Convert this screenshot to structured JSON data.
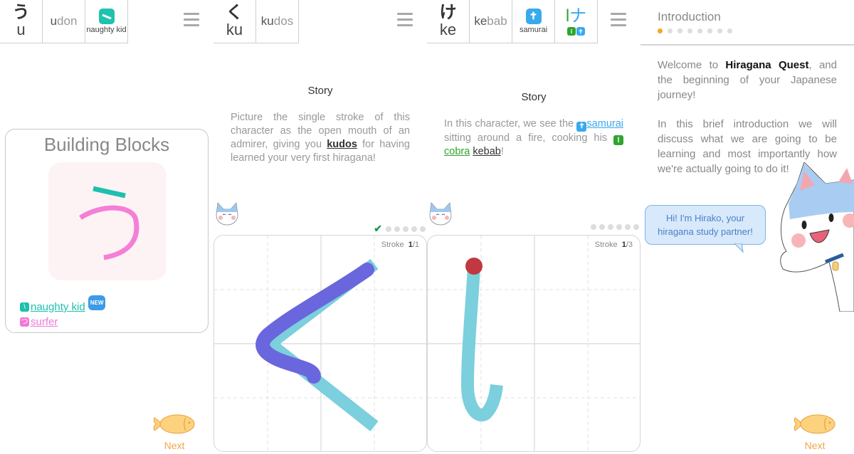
{
  "panel1": {
    "header": {
      "kana": "う",
      "romaji": "u",
      "word_highlight": "u",
      "word_rest": "don",
      "mnemonic_label": "naughty kid",
      "mnemonic_color": "#1fc2ae"
    },
    "card_title": "Building Blocks",
    "components": [
      {
        "label": "naughty kid",
        "color": "#1fbfae",
        "badge": "NEW"
      },
      {
        "label": "surfer",
        "color": "#f277d6",
        "badge": ""
      }
    ],
    "next_label": "Next"
  },
  "panel2": {
    "header": {
      "kana": "く",
      "romaji": "ku",
      "word_highlight": "ku",
      "word_rest": "dos"
    },
    "story_title": "Story",
    "story": {
      "before": "Picture the single stroke of this character as the open mouth of an admirer, giving you ",
      "keyword": "kudos",
      "after": " for having learned your very first hiragana!"
    },
    "progress": {
      "completed": 1,
      "remaining": 5
    },
    "stroke_label": "Stroke",
    "stroke_current": "1",
    "stroke_total": "/1"
  },
  "panel3": {
    "header": {
      "kana": "け",
      "romaji": "ke",
      "word_highlight": "ke",
      "word_rest": "bab",
      "mnemonic_label": "samurai",
      "mnemonic_color": "#39a9ee",
      "composite_kana_left": "l",
      "composite_kana_right": "ナ",
      "composite_left_color": "#2ea52e",
      "composite_right_color": "#39a9ee"
    },
    "story_title": "Story",
    "story": {
      "part1": "In this character, we see the ",
      "kw1": "samurai",
      "part2": " sitting around a fire, cooking his ",
      "kw2": "cobra",
      "part3": " ",
      "kw3": "kebab",
      "part4": "!"
    },
    "progress": {
      "completed": 0,
      "remaining": 6
    },
    "stroke_label": "Stroke",
    "stroke_current": "1",
    "stroke_total": "/3"
  },
  "panel4": {
    "title": "Introduction",
    "page_dots": {
      "current": 1,
      "total": 8
    },
    "para1_before": "Welcome to ",
    "para1_bold": "Hiragana Quest",
    "para1_after": ", and the beginning of your Japanese journey!",
    "para2": "In this brief introduction we will discuss what we are going to be learning and most importantly how we're actually going to do it!",
    "bubble_line1": "Hi! I'm Hirako, your",
    "bubble_line2": "hiragana study partner!",
    "next_label": "Next"
  },
  "colors": {
    "accent_orange": "#f5a623",
    "stroke_guide": "#7ccfdd",
    "stroke_user": "#6a66dd",
    "start_dot": "#c0393f"
  }
}
